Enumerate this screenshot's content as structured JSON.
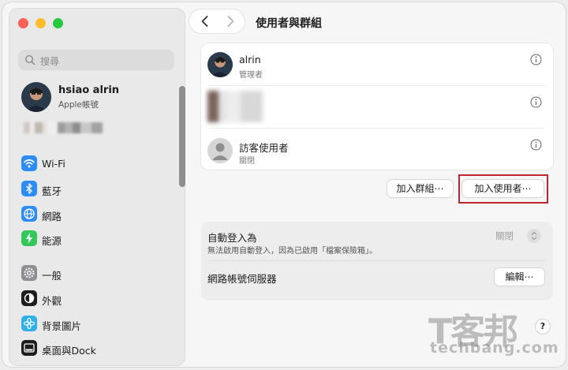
{
  "sidebar": {
    "search_placeholder": "搜尋",
    "profile": {
      "name": "hsiao alrin",
      "subtitle": "Apple帳號"
    },
    "items": [
      {
        "label": "Wi-Fi",
        "icon": "wifi-icon",
        "color": "#2e8cf7"
      },
      {
        "label": "藍牙",
        "icon": "bluetooth-icon",
        "color": "#2e8cf7"
      },
      {
        "label": "網路",
        "icon": "globe-icon",
        "color": "#2e8cf7"
      },
      {
        "label": "能源",
        "icon": "bolt-icon",
        "color": "#34c759"
      },
      {
        "label": "一般",
        "icon": "gear-icon",
        "color": "#8e8e93"
      },
      {
        "label": "外觀",
        "icon": "appearance-icon",
        "color": "#1d1d1f"
      },
      {
        "label": "背景圖片",
        "icon": "flower-icon",
        "color": "#30b0e8"
      },
      {
        "label": "桌面與Dock",
        "icon": "dock-icon",
        "color": "#1d1d1f"
      }
    ]
  },
  "header": {
    "title": "使用者與群組"
  },
  "users": [
    {
      "name": "alrin",
      "role": "管理者"
    },
    {
      "name": "訪客使用者",
      "role": "關閉"
    }
  ],
  "buttons": {
    "add_group": "加入群組⋯",
    "add_user": "加入使用者⋯"
  },
  "settings": {
    "auto_login": {
      "title": "自動登入為",
      "subtitle": "無法啟用自動登入，因為已啟用「檔案保險箱」。",
      "value": "關閉"
    },
    "network_server": {
      "title": "網路帳號伺服器",
      "button": "編輯⋯"
    }
  },
  "help": "?",
  "watermark": {
    "logo": "T客邦",
    "text": "techbang.com"
  }
}
